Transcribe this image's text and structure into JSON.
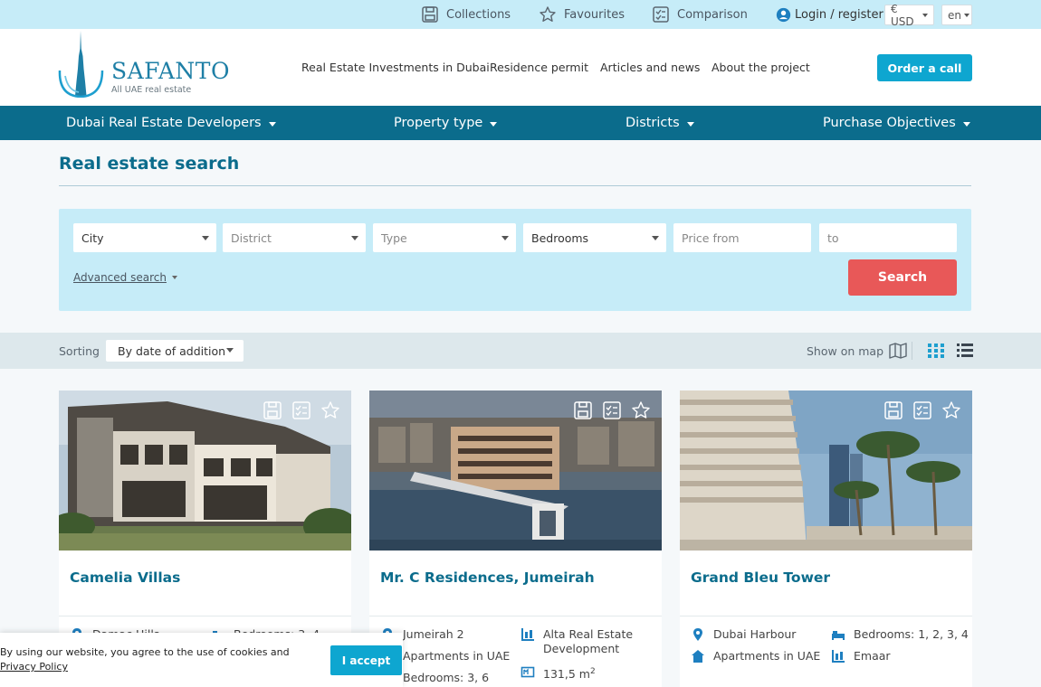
{
  "topbar": {
    "collections": "Collections",
    "favourites": "Favourites",
    "comparison": "Comparison",
    "login": "Login / register",
    "currency": "€ USD",
    "language": "en"
  },
  "brand": {
    "name": "SAFANTO",
    "tagline": "All UAE real estate"
  },
  "main_nav": {
    "investments": "Real Estate Investments in Dubai",
    "residence": "Residence permit",
    "articles": "Articles and news",
    "about": "About the project",
    "order_call": "Order a call"
  },
  "category_nav": {
    "developers": "Dubai Real Estate Developers",
    "property_type": "Property type",
    "districts": "Districts",
    "objectives": "Purchase Objectives"
  },
  "page_title": "Real estate search",
  "search": {
    "city": "City",
    "district": "District",
    "type": "Type",
    "bedrooms": "Bedrooms",
    "price_from": "Price from",
    "price_to": "to",
    "advanced": "Advanced search",
    "button": "Search"
  },
  "sorting": {
    "label": "Sorting",
    "value": "By date of addition",
    "show_on_map": "Show on map"
  },
  "cards": [
    {
      "title": "Camelia Villas",
      "location": "Damac Hills",
      "bedrooms": "Bedrooms: 3, 4",
      "category": "",
      "developer": "",
      "area": ""
    },
    {
      "title": "Mr. C Residences, Jumeirah",
      "location": "Jumeirah 2",
      "developer": "Alta Real Estate Development",
      "category": "Apartments in UAE",
      "bedrooms": "Bedrooms: 3, 6",
      "area": "131,5 m",
      "area_sup": "2"
    },
    {
      "title": "Grand Bleu Tower",
      "location": "Dubai Harbour",
      "bedrooms": "Bedrooms: 1, 2, 3, 4",
      "category": "Apartments in UAE",
      "developer": "Emaar"
    }
  ],
  "cookie": {
    "text": "By using our website, you agree to the use of cookies and",
    "link": "Privacy Policy",
    "button": "I accept"
  },
  "colors": {
    "accent": "#0ea6d0",
    "brand_dark": "#0b6c8c",
    "search_red": "#e85858",
    "topbar_bg": "#c6ecf8"
  }
}
